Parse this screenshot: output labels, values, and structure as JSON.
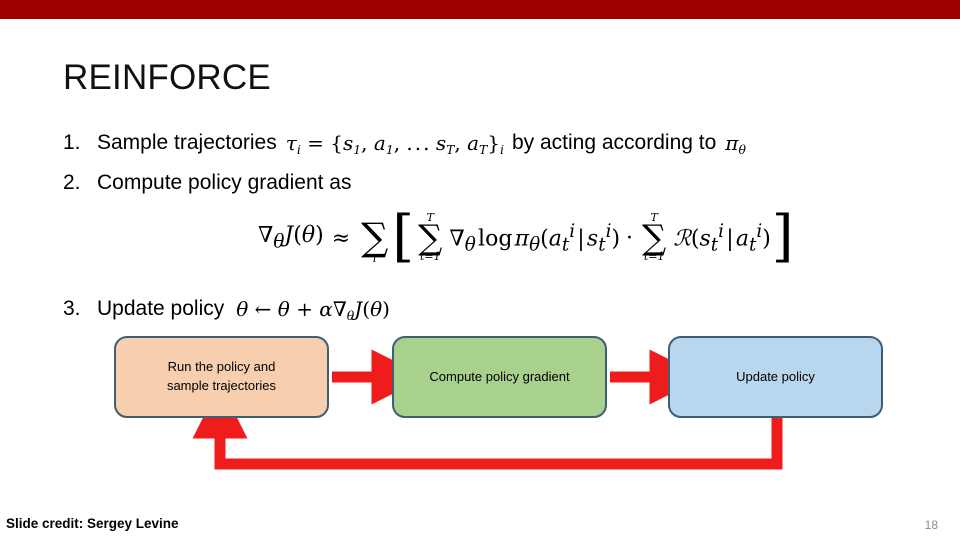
{
  "theme": {
    "band_color": "#9c0000",
    "arrow_color": "#ef1c1c",
    "box_border": "#3f5d73",
    "box_run_fill": "#f7cfae",
    "box_compute_fill": "#a9d18e",
    "box_update_fill": "#b9d6ef",
    "page_number_color": "#8b8b8b"
  },
  "slide": {
    "title": "REINFORCE",
    "credit": "Slide credit: Sergey Levine",
    "page_number": "18"
  },
  "steps": [
    {
      "number": "1.",
      "text_before": "Sample trajectories",
      "math": "τᵢ = {s₁, a₁, … s_T, a_T}ᵢ",
      "text_after": "by acting according to",
      "math_after": "πθ"
    },
    {
      "number": "2.",
      "text_before": "Compute policy gradient as",
      "math": "",
      "text_after": "",
      "math_after": ""
    },
    {
      "number": "3.",
      "text_before": "Update policy",
      "math": "θ ← θ + α∇θ J(θ)",
      "text_after": "",
      "math_after": ""
    }
  ],
  "equation": {
    "lhs": "∇θ J(θ)",
    "relation": "≈",
    "outer_sum_sub": "i",
    "inner_sum_1": {
      "lower": "t=1",
      "upper": "T"
    },
    "term_1": "∇θ log πθ(aₜⁱ | sₜⁱ)",
    "operator": "·",
    "inner_sum_2": {
      "lower": "t=1",
      "upper": "T"
    },
    "term_2": "ℛ(sₜⁱ | aₜⁱ)",
    "full_text": "∇θ J(θ) ≈ Σᵢ [ Σₜ₌₁ᵀ ∇θ log πθ(aₜⁱ | sₜⁱ) · Σₜ₌₁ᵀ ℛ(sₜⁱ | aₜⁱ) ]"
  },
  "flowchart": {
    "boxes": [
      {
        "id": "run",
        "label_line1": "Run the policy and",
        "label_line2": "sample trajectories"
      },
      {
        "id": "compute",
        "label_line1": "Compute policy gradient",
        "label_line2": ""
      },
      {
        "id": "update",
        "label_line1": "Update policy",
        "label_line2": ""
      }
    ],
    "arrows": [
      {
        "from": "run",
        "to": "compute",
        "direction": "right"
      },
      {
        "from": "compute",
        "to": "update",
        "direction": "right"
      },
      {
        "from": "update",
        "to": "run",
        "direction": "feedback-loop"
      }
    ]
  }
}
